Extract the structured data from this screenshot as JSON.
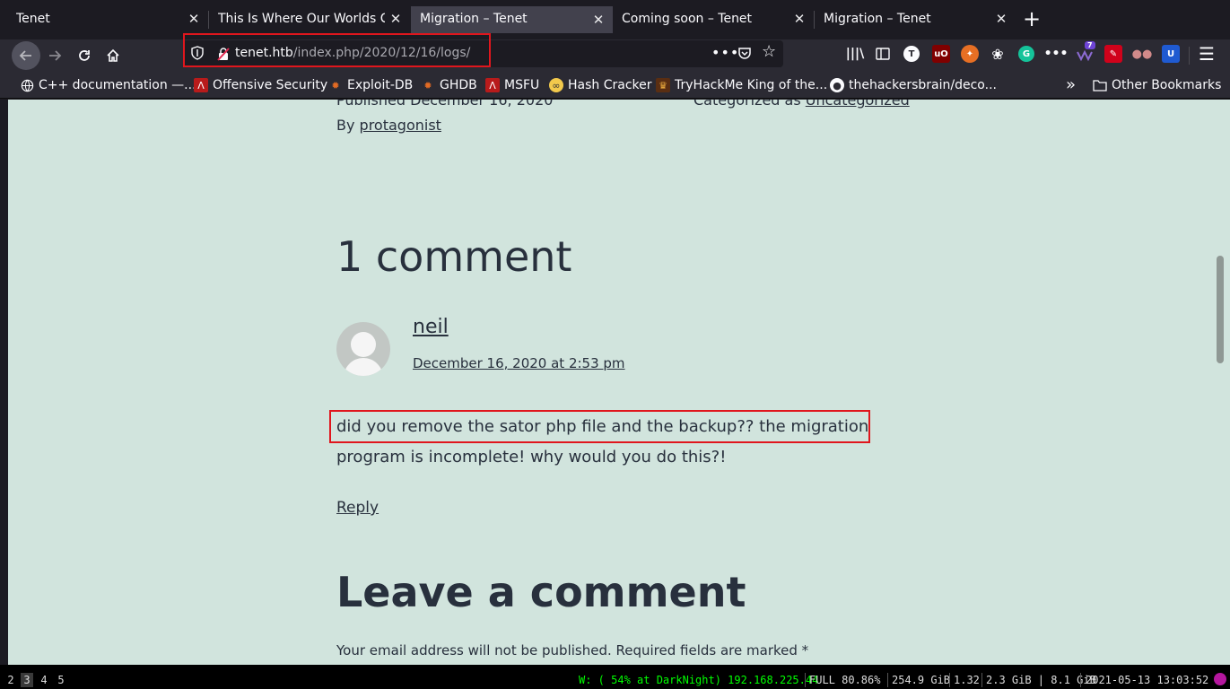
{
  "tabs": [
    {
      "title": "Tenet",
      "selected": false
    },
    {
      "title": "This Is Where Our Worlds Co",
      "selected": false
    },
    {
      "title": "Migration – Tenet",
      "selected": true
    },
    {
      "title": "Coming soon – Tenet",
      "selected": false
    },
    {
      "title": "Migration – Tenet",
      "selected": false
    }
  ],
  "tab_close_glyph": "✕",
  "new_tab_glyph": "+",
  "nav": {
    "back_icon": "arrow-left-icon",
    "forward_icon": "arrow-right-icon",
    "reload_icon": "reload-icon",
    "home_icon": "home-icon"
  },
  "url": {
    "host": "tenet.htb",
    "path": "/index.php/2020/12/16/logs/"
  },
  "bookmarks": [
    {
      "label": "C++ documentation —...",
      "icon": "globe-icon"
    },
    {
      "label": "Offensive Security",
      "icon": "offsec-icon"
    },
    {
      "label": "Exploit-DB",
      "icon": "exploitdb-icon"
    },
    {
      "label": "GHDB",
      "icon": "ghdb-icon"
    },
    {
      "label": "MSFU",
      "icon": "msfu-icon"
    },
    {
      "label": "Hash Cracker",
      "icon": "hashcracker-icon"
    },
    {
      "label": "TryHackMe King of the...",
      "icon": "tryhackme-icon"
    },
    {
      "label": "thehackersbrain/deco...",
      "icon": "github-icon"
    }
  ],
  "other_bookmarks": "Other Bookmarks",
  "extension_badge": "7",
  "page": {
    "published": "Published December 16, 2020",
    "by_prefix": "By ",
    "author": "protagonist",
    "categorized_prefix": "Categorized as ",
    "category": "Uncategorized",
    "comments_title": "1 comment",
    "comment": {
      "author": "neil",
      "date": "December 16, 2020 at 2:53 pm",
      "text": "did you remove the sator php file and the backup?? the migration program is incomplete! why would you do this?!",
      "reply": "Reply"
    },
    "leave_title": "Leave a comment",
    "leave_note": "Your email address will not be published. Required fields are marked *"
  },
  "status": {
    "workspaces": [
      "2",
      "3",
      "4",
      "5"
    ],
    "active_workspace": "3",
    "wifi": "W: ( 54% at DarkNight) 192.168.225.44",
    "battery": "FULL 80.86%",
    "disk": "254.9 GiB",
    "load": "1.32",
    "memory": "2.3 GiB | 8.1 GiB",
    "datetime": "2021-05-13 13:03:52"
  },
  "colors": {
    "page_bg": "#d1e4dd",
    "text": "#28303d",
    "highlight": "#e0161d",
    "wifi": "#00ff00"
  }
}
